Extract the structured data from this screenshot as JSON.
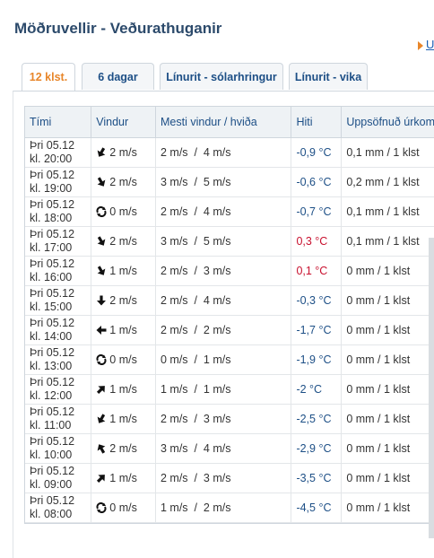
{
  "page": {
    "title": "Möðruvellir - Veðurathuganir",
    "up_link": "Up"
  },
  "tabs": [
    {
      "label": "12 klst.",
      "active": true
    },
    {
      "label": "6 dagar",
      "active": false
    },
    {
      "label": "Línurit - sólarhringur",
      "active": false
    },
    {
      "label": "Línurit - vika",
      "active": false
    }
  ],
  "table": {
    "headers": [
      "Tími",
      "Vindur",
      "Mesti vindur / hviða",
      "Hiti",
      "Uppsöfnuð úrkoma"
    ],
    "rows": [
      {
        "day": "Þri 05.12",
        "hour": "kl. 20:00",
        "wind_icon": "arrow-sw-icon",
        "wind": "2 m/s",
        "max": "2 m/s  /  4 m/s",
        "temp": "-0,9 °C",
        "temp_sign": "neg",
        "precip": "0,1 mm / 1 klst"
      },
      {
        "day": "Þri 05.12",
        "hour": "kl. 19:00",
        "wind_icon": "arrow-se-icon",
        "wind": "2 m/s",
        "max": "3 m/s  /  5 m/s",
        "temp": "-0,6 °C",
        "temp_sign": "neg",
        "precip": "0,2 mm / 1 klst"
      },
      {
        "day": "Þri 05.12",
        "hour": "kl. 18:00",
        "wind_icon": "variable-wind-icon",
        "wind": "0 m/s",
        "max": "2 m/s  /  4 m/s",
        "temp": "-0,7 °C",
        "temp_sign": "neg",
        "precip": "0,1 mm / 1 klst"
      },
      {
        "day": "Þri 05.12",
        "hour": "kl. 17:00",
        "wind_icon": "arrow-se-icon",
        "wind": "2 m/s",
        "max": "3 m/s  /  5 m/s",
        "temp": "0,3 °C",
        "temp_sign": "pos",
        "precip": "0,1 mm / 1 klst"
      },
      {
        "day": "Þri 05.12",
        "hour": "kl. 16:00",
        "wind_icon": "arrow-se-icon",
        "wind": "1 m/s",
        "max": "2 m/s  /  3 m/s",
        "temp": "0,1 °C",
        "temp_sign": "pos",
        "precip": "0 mm / 1 klst"
      },
      {
        "day": "Þri 05.12",
        "hour": "kl. 15:00",
        "wind_icon": "arrow-s-icon",
        "wind": "2 m/s",
        "max": "2 m/s  /  4 m/s",
        "temp": "-0,3 °C",
        "temp_sign": "neg",
        "precip": "0 mm / 1 klst"
      },
      {
        "day": "Þri 05.12",
        "hour": "kl. 14:00",
        "wind_icon": "arrow-w-icon",
        "wind": "1 m/s",
        "max": "2 m/s  /  2 m/s",
        "temp": "-1,7 °C",
        "temp_sign": "neg",
        "precip": "0 mm / 1 klst"
      },
      {
        "day": "Þri 05.12",
        "hour": "kl. 13:00",
        "wind_icon": "variable-wind-icon",
        "wind": "0 m/s",
        "max": "0 m/s  /  1 m/s",
        "temp": "-1,9 °C",
        "temp_sign": "neg",
        "precip": "0 mm / 1 klst"
      },
      {
        "day": "Þri 05.12",
        "hour": "kl. 12:00",
        "wind_icon": "arrow-ne-icon",
        "wind": "1 m/s",
        "max": "1 m/s  /  1 m/s",
        "temp": "-2 °C",
        "temp_sign": "neg",
        "precip": "0 mm / 1 klst"
      },
      {
        "day": "Þri 05.12",
        "hour": "kl. 11:00",
        "wind_icon": "arrow-sw-icon",
        "wind": "1 m/s",
        "max": "2 m/s  /  3 m/s",
        "temp": "-2,5 °C",
        "temp_sign": "neg",
        "precip": "0 mm / 1 klst"
      },
      {
        "day": "Þri 05.12",
        "hour": "kl. 10:00",
        "wind_icon": "arrow-nw-icon",
        "wind": "2 m/s",
        "max": "3 m/s  /  4 m/s",
        "temp": "-2,9 °C",
        "temp_sign": "neg",
        "precip": "0 mm / 1 klst"
      },
      {
        "day": "Þri 05.12",
        "hour": "kl. 09:00",
        "wind_icon": "arrow-ne-icon",
        "wind": "1 m/s",
        "max": "2 m/s  /  3 m/s",
        "temp": "-3,5 °C",
        "temp_sign": "neg",
        "precip": "0 mm / 1 klst"
      },
      {
        "day": "Þri 05.12",
        "hour": "kl. 08:00",
        "wind_icon": "variable-wind-icon",
        "wind": "0 m/s",
        "max": "1 m/s  /  2 m/s",
        "temp": "-4,5 °C",
        "temp_sign": "neg",
        "precip": "0 mm / 1 klst"
      }
    ]
  },
  "colors": {
    "heading": "#2c4a6b",
    "link": "#1d4f86",
    "accent": "#e8862a",
    "temp_negative": "#1d4f86",
    "temp_positive": "#c8102e"
  }
}
